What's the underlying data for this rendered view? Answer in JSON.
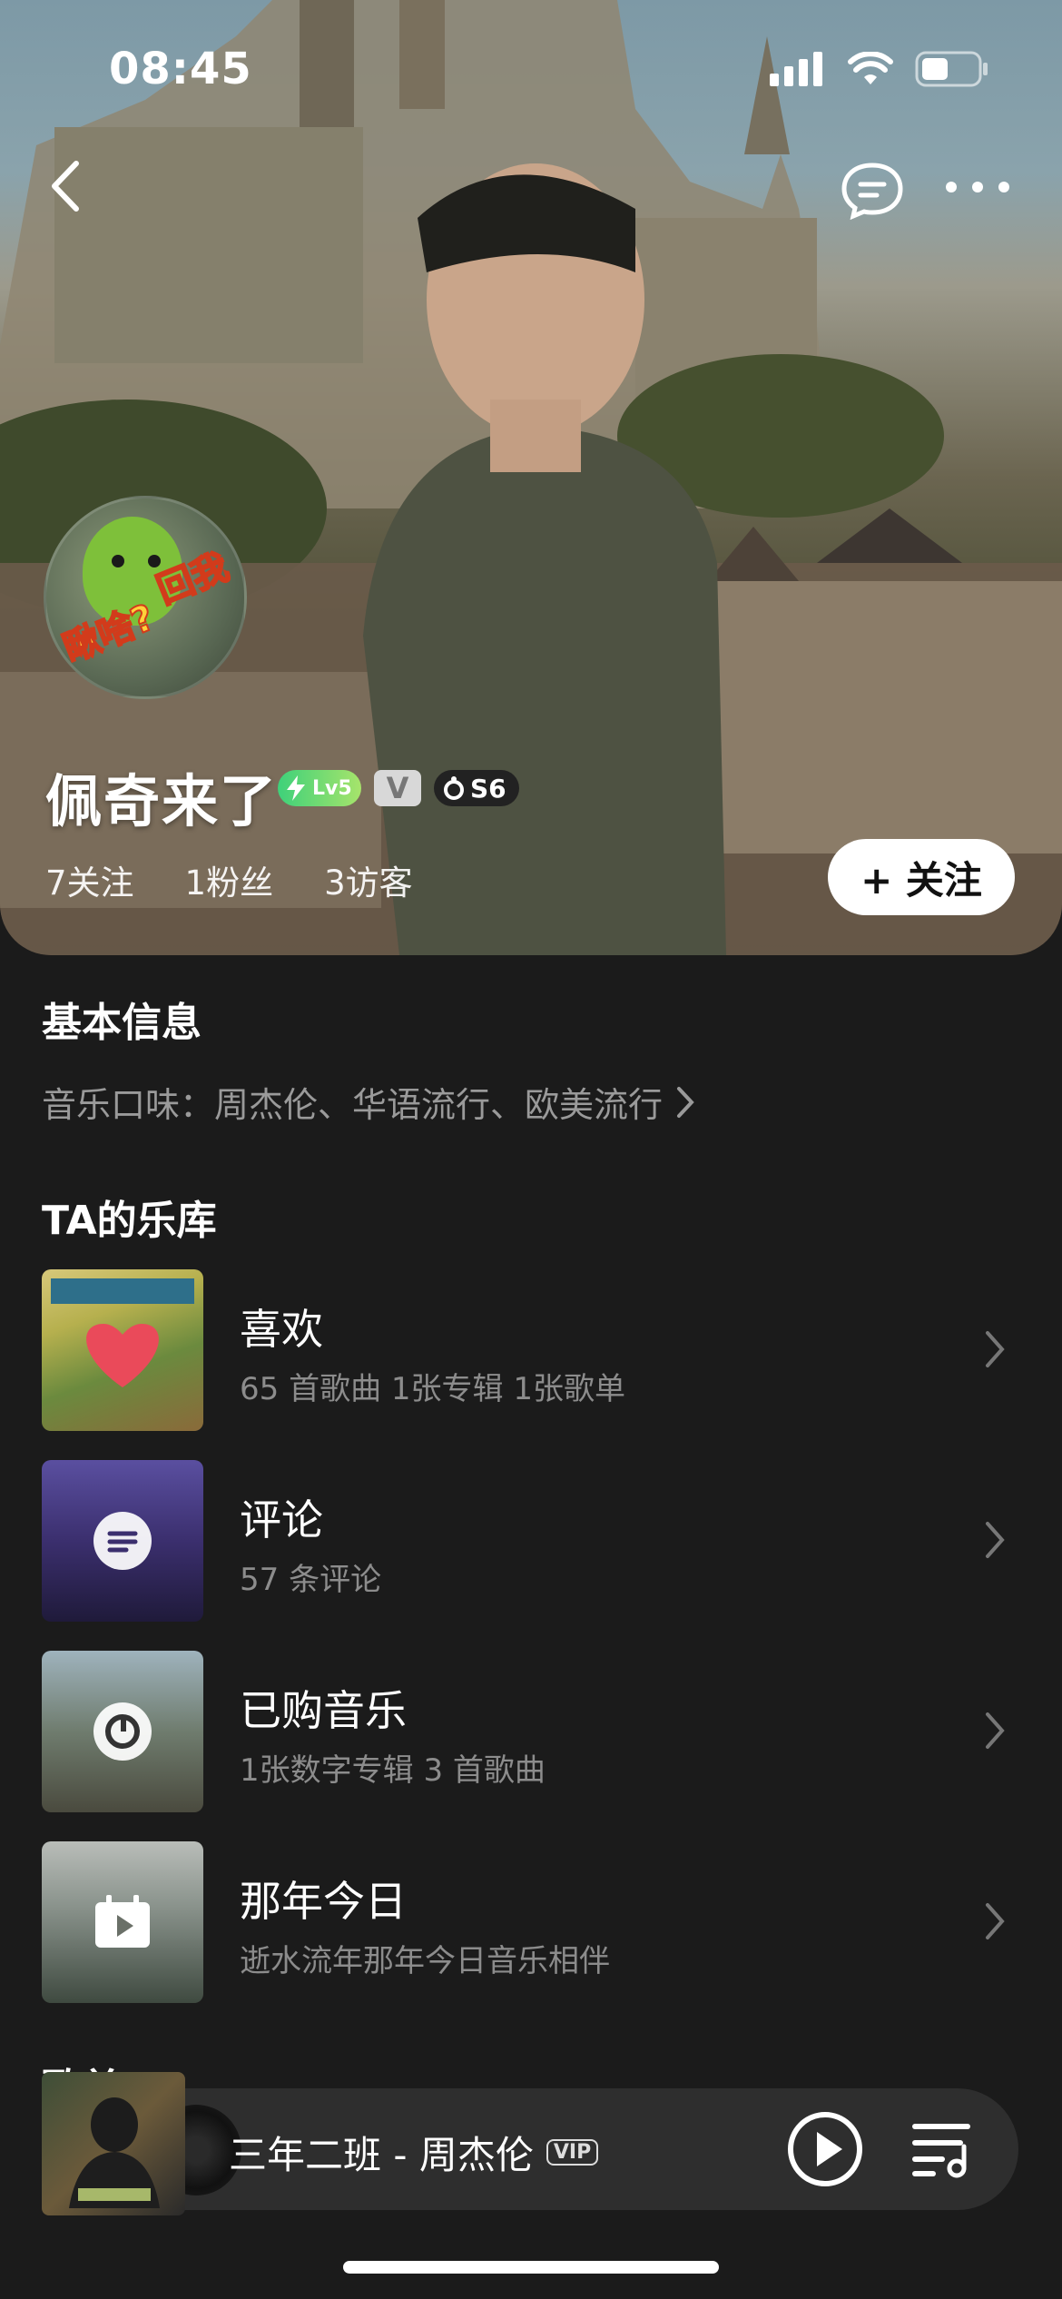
{
  "status_bar": {
    "time": "08:45"
  },
  "profile": {
    "username": "佩奇来了",
    "avatar_text_a": "瞅啥?",
    "avatar_text_b": "回我",
    "badge_level": "Lv5",
    "badge_v": "V",
    "badge_s": "S6",
    "stats": {
      "following": "7关注",
      "fans": "1粉丝",
      "visitors": "3访客"
    },
    "follow_label": "+ 关注"
  },
  "basic_info": {
    "title": "基本信息",
    "music_taste": "音乐口味：周杰伦、华语流行、欧美流行"
  },
  "library": {
    "title": "TA的乐库",
    "items": [
      {
        "title": "喜欢",
        "subtitle": "65 首歌曲 1张专辑 1张歌单",
        "icon": "heart-icon"
      },
      {
        "title": "评论",
        "subtitle": "57 条评论",
        "icon": "comment-icon"
      },
      {
        "title": "已购音乐",
        "subtitle": "1张数字专辑 3 首歌曲",
        "icon": "music-disc-icon"
      },
      {
        "title": "那年今日",
        "subtitle": "逝水流年那年今日音乐相伴",
        "icon": "calendar-play-icon"
      }
    ]
  },
  "peek_section": {
    "title": "歌单"
  },
  "player": {
    "song": "三年二班 - 周杰伦",
    "vip": "VIP"
  },
  "colors": {
    "background": "#1b1b1b",
    "secondary_text": "#8c8c8c",
    "follow_button": "#ffffff"
  }
}
